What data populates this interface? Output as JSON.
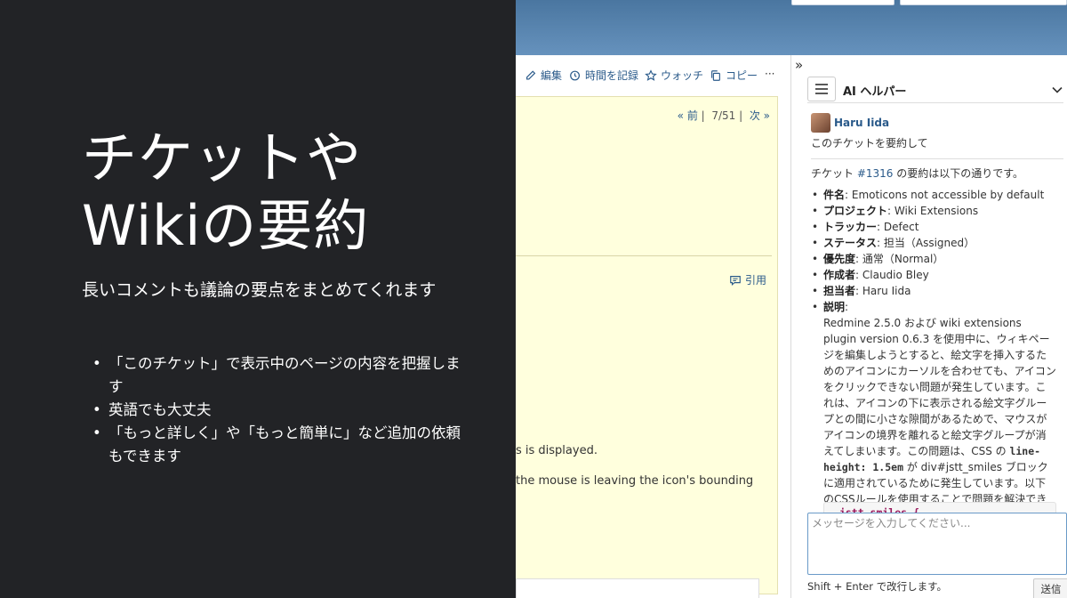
{
  "slide": {
    "title_line1": "チケットや",
    "title_line2": "Wikiの要約",
    "subtitle": "長いコメントも議論の要点をまとめてくれます",
    "bullets": [
      "「このチケット」で表示中のページの内容を把握します",
      "英語でも大丈夫",
      "「もっと詳しく」や「もっと簡単に」など追加の依頼もできます"
    ]
  },
  "header": {
    "partial_text": "···"
  },
  "toolbar": {
    "edit": "編集",
    "log_time": "時間を記録",
    "watch": "ウォッチ",
    "copy": "コピー",
    "more": "···"
  },
  "issue": {
    "pager_prev": "« 前",
    "pager_sep1": "|",
    "pager_pos": "7/51",
    "pager_sep2": "|",
    "pager_next": "次 »",
    "quote": "引用",
    "desc_line1": "s is displayed.",
    "desc_line2": "the mouse is leaving the icon's bounding"
  },
  "sidebar": {
    "collapse": "»",
    "title": "AI ヘルパー",
    "user_name": "Haru Iida",
    "user_message": "このチケットを要約して",
    "response_intro_pre": "チケット ",
    "response_ticket": "#1316",
    "response_intro_post": " の要約は以下の通りです。",
    "fields": [
      {
        "label": "件名",
        "value": ": Emoticons not accessible by default"
      },
      {
        "label": "プロジェクト",
        "value": ": Wiki Extensions"
      },
      {
        "label": "トラッカー",
        "value": ": Defect"
      },
      {
        "label": "ステータス",
        "value": ": 担当（Assigned）"
      },
      {
        "label": "優先度",
        "value": ": 通常（Normal）"
      },
      {
        "label": "作成者",
        "value": ": Claudio Bley"
      },
      {
        "label": "担当者",
        "value": ": Haru Iida"
      },
      {
        "label": "説明",
        "value": ":"
      }
    ],
    "description_part1": "Redmine 2.5.0 および wiki extensions plugin version 0.6.3 を使用中に、ウィキページを編集しようとすると、絵文字を挿入するためのアイコンにカーソルを合わせても、アイコンをクリックできない問題が発生しています。これは、アイコンの下に表示される絵文字グループとの間に小さな隙間があるためで、マウスがアイコンの境界を離れると絵文字グループが消えてしまいます。この問題は、CSS の ",
    "description_code": "line-height: 1.5em",
    "description_part2": " が div#jstt_smiles ブロックに適用されているために発生しています。以下のCSSルールを使用することで問題を解決できます。",
    "code_snippet": ".jstt_smiles {",
    "input_placeholder": "メッセージを入力してください...",
    "hint": "Shift + Enter で改行します。",
    "send": "送信"
  }
}
